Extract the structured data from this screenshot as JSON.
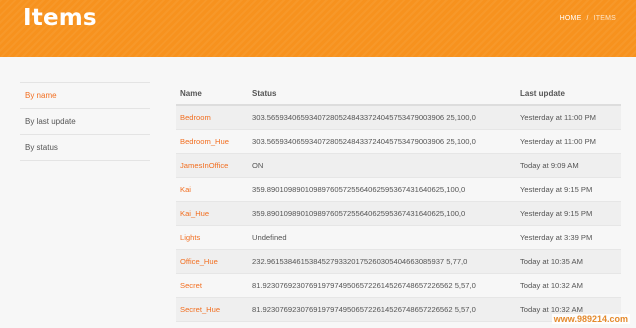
{
  "header": {
    "title": "Items",
    "breadcrumb": {
      "home": "HOME",
      "separator": "/",
      "current": "ITEMS"
    }
  },
  "sidebar": {
    "items": [
      {
        "label": "By name",
        "active": true
      },
      {
        "label": "By last update",
        "active": false
      },
      {
        "label": "By status",
        "active": false
      }
    ]
  },
  "table": {
    "columns": [
      "Name",
      "Status",
      "Last update"
    ],
    "rows": [
      {
        "name": "Bedroom",
        "status": "303.565934065934072805248433724045753479003906 25,100,0",
        "updated": "Yesterday at 11:00 PM"
      },
      {
        "name": "Bedroom_Hue",
        "status": "303.565934065934072805248433724045753479003906 25,100,0",
        "updated": "Yesterday at 11:00 PM"
      },
      {
        "name": "JamesInOffice",
        "status": "ON",
        "updated": "Today at 9:09 AM"
      },
      {
        "name": "Kai",
        "status": "359.890109890109897605725564062595367431640625,100,0",
        "updated": "Yesterday at 9:15 PM"
      },
      {
        "name": "Kai_Hue",
        "status": "359.890109890109897605725564062595367431640625,100,0",
        "updated": "Yesterday at 9:15 PM"
      },
      {
        "name": "Lights",
        "status": "Undefined",
        "updated": "Yesterday at 3:39 PM"
      },
      {
        "name": "Office_Hue",
        "status": "232.961538461538452793320175260305404663085937 5,77,0",
        "updated": "Today at 10:35 AM"
      },
      {
        "name": "Secret",
        "status": "81.923076923076919797495065722614526748657226562 5,57,0",
        "updated": "Today at 10:32 AM"
      },
      {
        "name": "Secret_Hue",
        "status": "81.923076923076919797495065722614526748657226562 5,57,0",
        "updated": "Today at 10:32 AM"
      }
    ]
  },
  "watermark": "www.989214.com",
  "colors": {
    "accent": "#f7921e",
    "link": "#f26f21"
  }
}
